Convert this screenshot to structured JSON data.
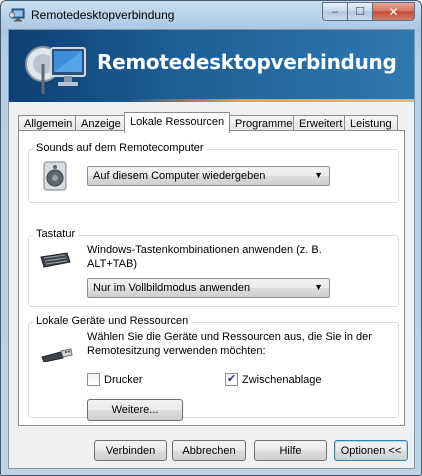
{
  "window": {
    "title": "Remotedesktopverbindung",
    "caption": {
      "minimize": "–",
      "maximize": "☐",
      "close": "✕"
    }
  },
  "banner": {
    "title": "Remotedesktopverbindung"
  },
  "tabs": [
    {
      "label": "Allgemein",
      "active": false
    },
    {
      "label": "Anzeige",
      "active": false
    },
    {
      "label": "Lokale Ressourcen",
      "active": true
    },
    {
      "label": "Programme",
      "active": false
    },
    {
      "label": "Erweitert",
      "active": false
    },
    {
      "label": "Leistung",
      "active": false
    }
  ],
  "sounds": {
    "group_label": "Sounds auf dem Remotecomputer",
    "selected": "Auf diesem Computer wiedergeben"
  },
  "keyboard": {
    "group_label": "Tastatur",
    "description": "Windows-Tastenkombinationen anwenden (z. B. ALT+TAB)",
    "selected": "Nur im Vollbildmodus anwenden"
  },
  "devices": {
    "group_label": "Lokale Geräte und Ressourcen",
    "description": "Wählen Sie die Geräte und Ressourcen aus, die Sie in der Remotesitzung verwenden möchten:",
    "printer_label": "Drucker",
    "printer_checked": false,
    "clipboard_label": "Zwischenablage",
    "clipboard_checked": true,
    "more_label": "Weitere..."
  },
  "footer": {
    "connect": "Verbinden",
    "cancel": "Abbrechen",
    "help": "Hilfe",
    "options": "Optionen <<"
  },
  "icons": {
    "title": "remote-desktop-icon",
    "banner": "monitor-satellite-icon",
    "sounds": "speaker-icon",
    "keyboard": "keyboard-icon",
    "devices": "usb-plug-icon"
  },
  "colors": {
    "banner_dark": "#0d3f73",
    "banner_light": "#2e79b0",
    "accent_stripe": "#ff9a30",
    "close_button": "#c24a33"
  }
}
